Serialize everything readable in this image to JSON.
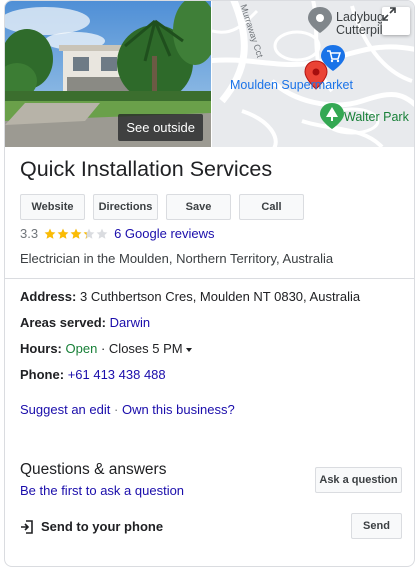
{
  "photo": {
    "overlay_label": "See outside"
  },
  "map": {
    "labels": {
      "ladybugs": "Ladybugs",
      "ladybugs2": "Cutterpilla",
      "supermarket": "Moulden Supermarket",
      "park": "Walter Park",
      "street": "Murraway Cct"
    },
    "icons": {
      "expand": "expand-icon",
      "ladybugs_pin": "pin-icon",
      "supermarket_pin": "shopping-cart-icon",
      "park_pin": "tree-icon",
      "business_pin": "location-marker-icon"
    }
  },
  "business": {
    "name": "Quick Installation Services",
    "rating": "3.3",
    "reviews_label": "6 Google reviews",
    "category": "Electrician in the Moulden, Northern Territory, Australia",
    "stars_filled": 3.3,
    "stars_total": 5
  },
  "actions": {
    "website": "Website",
    "directions": "Directions",
    "save": "Save",
    "call": "Call"
  },
  "info": {
    "address_label": "Address:",
    "address_value": "3 Cuthbertson Cres, Moulden NT 0830, Australia",
    "areas_label": "Areas served:",
    "areas_value": "Darwin",
    "hours_label": "Hours:",
    "hours_open": "Open",
    "hours_sep": "·",
    "hours_close": "Closes 5 PM",
    "phone_label": "Phone:",
    "phone_value": "+61 413 438 488"
  },
  "links": {
    "suggest": "Suggest an edit",
    "sep": "·",
    "own": "Own this business?"
  },
  "qa": {
    "title": "Questions & answers",
    "subtitle": "Be the first to ask a question",
    "ask_button": "Ask a question"
  },
  "send": {
    "label": "Send to your phone",
    "button": "Send"
  },
  "colors": {
    "link": "#1a0dab",
    "open": "#188038",
    "star": "#fbbc04",
    "star_empty": "#dadce0",
    "map_blue": "#1a73e8",
    "pin_red": "#ea4335"
  }
}
